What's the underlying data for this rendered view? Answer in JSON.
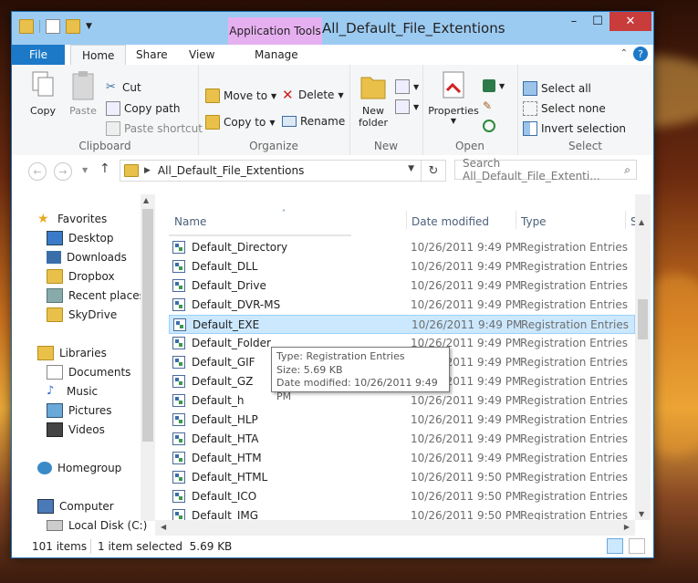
{
  "window": {
    "title": "All_Default_File_Extentions",
    "context_tab_header": "Application Tools",
    "controls": {
      "minimize": "–",
      "maximize": "☐",
      "close": "✕"
    }
  },
  "ribbon_tabs": [
    "File",
    "Home",
    "Share",
    "View",
    "Manage"
  ],
  "ribbon": {
    "clipboard": {
      "label": "Clipboard",
      "copy": "Copy",
      "paste": "Paste",
      "cut": "Cut",
      "copy_path": "Copy path",
      "paste_shortcut": "Paste shortcut"
    },
    "organize": {
      "label": "Organize",
      "move_to": "Move to",
      "copy_to": "Copy to",
      "delete": "Delete",
      "rename": "Rename"
    },
    "new": {
      "label": "New",
      "new_folder_line1": "New",
      "new_folder_line2": "folder"
    },
    "open": {
      "label": "Open",
      "properties": "Properties"
    },
    "select": {
      "label": "Select",
      "select_all": "Select all",
      "select_none": "Select none",
      "invert_selection": "Invert selection"
    }
  },
  "address": {
    "path": "All_Default_File_Extentions",
    "search_placeholder": "Search All_Default_File_Extenti..."
  },
  "nav_pane": {
    "favorites": "Favorites",
    "favorites_items": [
      "Desktop",
      "Downloads",
      "Dropbox",
      "Recent places",
      "SkyDrive"
    ],
    "libraries": "Libraries",
    "libraries_items": [
      "Documents",
      "Music",
      "Pictures",
      "Videos"
    ],
    "homegroup": "Homegroup",
    "computer": "Computer",
    "computer_items": [
      "Local Disk (C:)"
    ]
  },
  "columns": {
    "name": "Name",
    "date_modified": "Date modified",
    "type": "Type",
    "size_partial": "S"
  },
  "files": [
    {
      "name": "Default_Directory",
      "date": "10/26/2011 9:49 PM",
      "type": "Registration Entries"
    },
    {
      "name": "Default_DLL",
      "date": "10/26/2011 9:49 PM",
      "type": "Registration Entries"
    },
    {
      "name": "Default_Drive",
      "date": "10/26/2011 9:49 PM",
      "type": "Registration Entries"
    },
    {
      "name": "Default_DVR-MS",
      "date": "10/26/2011 9:49 PM",
      "type": "Registration Entries"
    },
    {
      "name": "Default_EXE",
      "date": "10/26/2011 9:49 PM",
      "type": "Registration Entries",
      "selected": true
    },
    {
      "name": "Default_Folder",
      "date": "10/26/2011 9:49 PM",
      "type": "Registration Entries"
    },
    {
      "name": "Default_GIF",
      "date": "10/26/2011 9:49 PM",
      "type": "Registration Entries"
    },
    {
      "name": "Default_GZ",
      "date": "10/26/2011 9:49 PM",
      "type": "Registration Entries"
    },
    {
      "name": "Default_h",
      "date": "10/26/2011 9:49 PM",
      "type": "Registration Entries"
    },
    {
      "name": "Default_HLP",
      "date": "10/26/2011 9:49 PM",
      "type": "Registration Entries"
    },
    {
      "name": "Default_HTA",
      "date": "10/26/2011 9:49 PM",
      "type": "Registration Entries"
    },
    {
      "name": "Default_HTM",
      "date": "10/26/2011 9:49 PM",
      "type": "Registration Entries"
    },
    {
      "name": "Default_HTML",
      "date": "10/26/2011 9:50 PM",
      "type": "Registration Entries"
    },
    {
      "name": "Default_ICO",
      "date": "10/26/2011 9:50 PM",
      "type": "Registration Entries"
    },
    {
      "name": "Default_IMG",
      "date": "10/26/2011 9:50 PM",
      "type": "Registration Entries"
    }
  ],
  "tooltip": {
    "type_line": "Type: Registration Entries",
    "size_line": "Size: 5.69 KB",
    "date_line": "Date modified: 10/26/2011 9:49 PM"
  },
  "status": {
    "items_count": "101 items",
    "selection": "1 item selected  5.69 KB"
  },
  "colors": {
    "accent": "#1c79c8",
    "titlebar": "#9ccbf2",
    "context_tab": "#e6b0f0",
    "selection": "#cce8ff"
  }
}
